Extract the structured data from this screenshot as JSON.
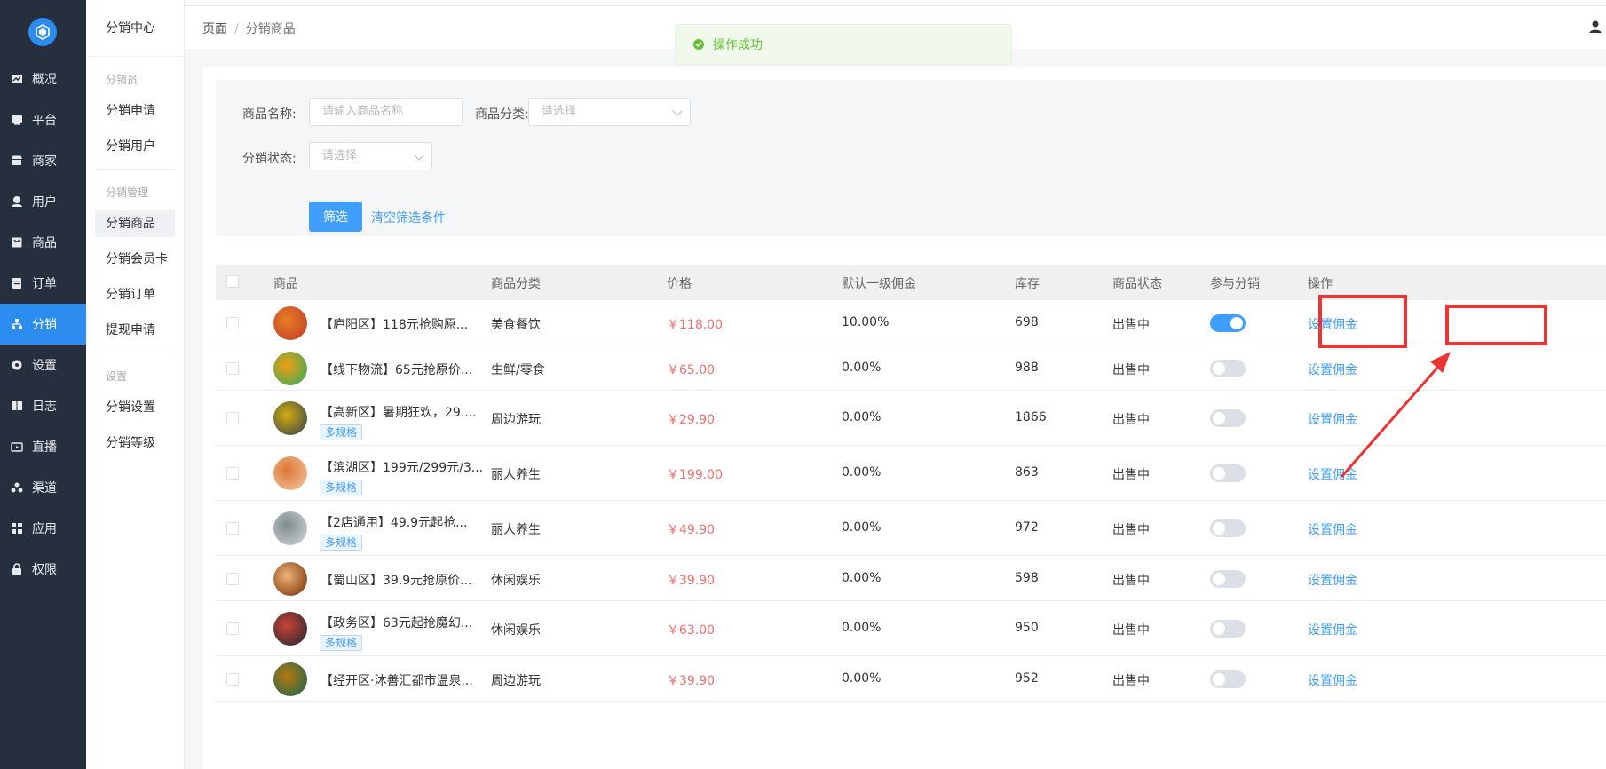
{
  "nav": {
    "items": [
      {
        "label": "概况",
        "icon": "dashboard-icon"
      },
      {
        "label": "平台",
        "icon": "monitor-icon"
      },
      {
        "label": "商家",
        "icon": "store-icon"
      },
      {
        "label": "用户",
        "icon": "user-icon"
      },
      {
        "label": "商品",
        "icon": "goods-icon"
      },
      {
        "label": "订单",
        "icon": "order-icon"
      },
      {
        "label": "分销",
        "icon": "distribution-icon",
        "active": true
      },
      {
        "label": "设置",
        "icon": "gear-icon"
      },
      {
        "label": "日志",
        "icon": "log-icon"
      },
      {
        "label": "直播",
        "icon": "live-icon"
      },
      {
        "label": "渠道",
        "icon": "channel-icon"
      },
      {
        "label": "应用",
        "icon": "apps-icon"
      },
      {
        "label": "权限",
        "icon": "lock-icon"
      }
    ]
  },
  "subnav": {
    "title": "分销中心",
    "group1": "分销员",
    "item1": "分销申请",
    "item2": "分销用户",
    "group2": "分销管理",
    "item3": "分销商品",
    "item4": "分销会员卡",
    "item5": "分销订单",
    "item6": "提现申请",
    "group3": "设置",
    "item7": "分销设置",
    "item8": "分销等级"
  },
  "breadcrumb": {
    "root": "页面",
    "sep": "/",
    "current": "分销商品"
  },
  "toast": {
    "message": "操作成功"
  },
  "filter": {
    "name_label": "商品名称:",
    "name_placeholder": "请输入商品名称",
    "category_label": "商品分类:",
    "category_placeholder": "请选择",
    "status_label": "分销状态:",
    "status_placeholder": "请选择",
    "filter_button": "筛选",
    "clear_link": "清空筛选条件"
  },
  "table": {
    "headers": {
      "goods": "商品",
      "category": "商品分类",
      "price": "价格",
      "commission": "默认一级佣金",
      "stock": "库存",
      "status": "商品状态",
      "join": "参与分销",
      "ops": "操作"
    },
    "rows": [
      {
        "name": "【庐阳区】118元抢购原...",
        "tag": "",
        "category": "美食餐饮",
        "price": "￥118.00",
        "commission": "10.00%",
        "stock": "698",
        "status": "出售中",
        "join": true,
        "op": "设置佣金"
      },
      {
        "name": "【线下物流】65元抢原价...",
        "tag": "",
        "category": "生鲜/零食",
        "price": "￥65.00",
        "commission": "0.00%",
        "stock": "988",
        "status": "出售中",
        "join": false,
        "op": "设置佣金"
      },
      {
        "name": "【高新区】暑期狂欢，29....",
        "tag": "多规格",
        "category": "周边游玩",
        "price": "￥29.90",
        "commission": "0.00%",
        "stock": "1866",
        "status": "出售中",
        "join": false,
        "op": "设置佣金"
      },
      {
        "name": "【滨湖区】199元/299元/3...",
        "tag": "多规格",
        "category": "丽人养生",
        "price": "￥199.00",
        "commission": "0.00%",
        "stock": "863",
        "status": "出售中",
        "join": false,
        "op": "设置佣金"
      },
      {
        "name": "【2店通用】49.9元起抢...",
        "tag": "多规格",
        "category": "丽人养生",
        "price": "￥49.90",
        "commission": "0.00%",
        "stock": "972",
        "status": "出售中",
        "join": false,
        "op": "设置佣金"
      },
      {
        "name": "【蜀山区】39.9元抢原价...",
        "tag": "",
        "category": "休闲娱乐",
        "price": "￥39.90",
        "commission": "0.00%",
        "stock": "598",
        "status": "出售中",
        "join": false,
        "op": "设置佣金"
      },
      {
        "name": "【政务区】63元起抢魔幻...",
        "tag": "多规格",
        "category": "休闲娱乐",
        "price": "￥63.00",
        "commission": "0.00%",
        "stock": "950",
        "status": "出售中",
        "join": false,
        "op": "设置佣金"
      },
      {
        "name": "【经开区·沐善汇都市温泉...",
        "tag": "",
        "category": "周边游玩",
        "price": "￥39.90",
        "commission": "0.00%",
        "stock": "952",
        "status": "出售中",
        "join": false,
        "op": "设置佣金"
      }
    ]
  },
  "colors": {
    "accent": "#409eff",
    "nav_bg": "#262f3e",
    "price": "#f56c6c",
    "annotation": "#ee3333"
  }
}
